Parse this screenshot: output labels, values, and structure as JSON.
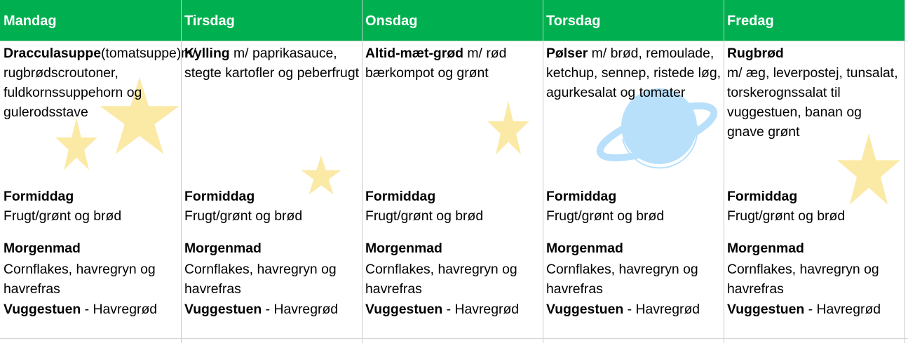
{
  "days": [
    "Mandag",
    "Tirsdag",
    "Onsdag",
    "Torsdag",
    "Fredag"
  ],
  "meals": [
    {
      "name": "Dracculasuppe",
      "desc": "(tomatsuppe)m/ rugbrødscroutoner, fuldkornssuppehorn og gulerodsstave"
    },
    {
      "name": "Kylling",
      "desc": " m/ paprikasauce, stegte kartofler og peberfrugt"
    },
    {
      "name": "Altid-mæt-grød",
      "desc": " m/ rød bærkompot og grønt"
    },
    {
      "name": "Pølser",
      "desc": " m/ brød, remoulade, ketchup, sennep, ristede løg, agurkesalat og tomater"
    },
    {
      "name": "Rugbrød",
      "desc": "m/ æg, leverpostej, tunsalat, torskerognssalat til vuggestuen, banan og gnave grønt"
    }
  ],
  "snack": {
    "label": "Formiddag",
    "text": "Frugt/grønt og brød"
  },
  "breakfast": {
    "label": "Morgenmad",
    "text": "Cornflakes, havregryn og havrefras"
  },
  "nursery": {
    "label": "Vuggestuen",
    "text": " - Havregrød"
  },
  "colors": {
    "header": "#00b050",
    "star": "#fbe9a6",
    "planet": "#b9e0fb"
  },
  "decorations": [
    "star-icon",
    "star-icon",
    "star-icon",
    "star-icon",
    "planet-icon",
    "star-icon"
  ]
}
